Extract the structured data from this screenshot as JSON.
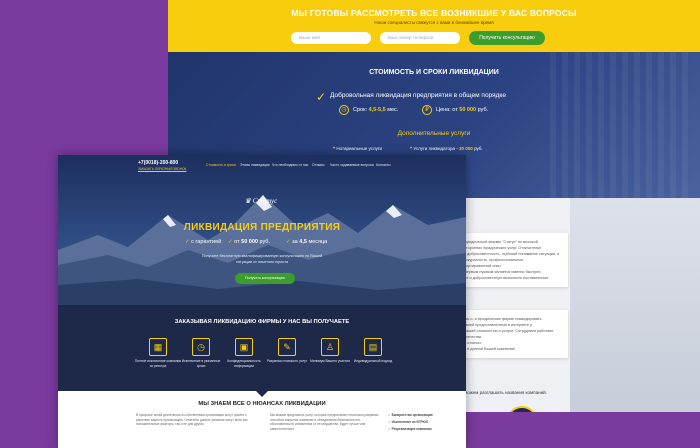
{
  "back": {
    "title": "МЫ ГОТОВЫ РАССМОТРЕТЬ ВСЕ ВОЗНИКШИЕ У ВАС ВОПРОСЫ",
    "subtitle": "Наши специалисты свяжутся с вами в ближайшее время",
    "name_placeholder": "Ваше имя",
    "phone_placeholder": "Ваш номер телефона",
    "consult_button": "Получить консультацию",
    "cost_title": "СТОИМОСТЬ И СРОКИ ЛИКВИДАЦИИ",
    "voluntary": "Добровольная ликвидация предприятия в общем порядке",
    "term_label": "Срок:",
    "term_value": "4,5-5,5",
    "term_unit": "мес.",
    "price_label": "Цена: от",
    "price_value": "50 000",
    "price_unit": "руб.",
    "additional_title": "Дополнительные услуги",
    "service1": "Нотариальные услуги",
    "service2_label": "Услуги ликвидатора -",
    "service2_value": "30 000",
    "service2_unit": "руб.",
    "card1_lines": [
      "юридической фирмы \"Статус\" по высокой",
      "сторонних юридических услуг. Отличительн",
      "и добросовестность, глубокий понимание ситуации, и аккуратность, профессиональное",
      "сортированный опыт.",
      "Первым нужным является именно быстрее,",
      "ют и добросовестную выполнить поставленные"
    ],
    "card2_lines": [
      "мы и, в юридические фирме ликвидировать",
      "своей предоставленный в интернете у",
      "нашей стоимостью и услуги: Сотрудники работают",
      "агентства",
      "и отлично",
      "и в данной Вашей компании!"
    ],
    "bottom_line": "не можем разглашать названия компаний."
  },
  "front": {
    "phone": "+7(0018)-200-800",
    "callback": "ЗАКАЗАТЬ ОБРАТНЫЙ ЗВОНОК",
    "nav": [
      "Стоимость и сроки",
      "Этапы ликвидации",
      "Что необходимо от нас",
      "Отзывы",
      "Часто задаваемые вопросы",
      "Контакты"
    ],
    "logo": "Статус",
    "hero_title": "ЛИКВИДАЦИЯ ПРЕДПРИЯТИЯ",
    "feat1": "с гарантией",
    "feat2_pre": "от",
    "feat2_val": "50 000",
    "feat2_unit": "руб.",
    "feat3_pre": "за",
    "feat3_val": "4,5",
    "feat3_unit": "месяца",
    "hero_text": "Получите бесплатную квалифицированную консультацию по Вашей ситуации от опытного юриста",
    "hero_button": "Получить консультацию",
    "dark_title": "ЗАКАЗЫВАЯ ЛИКВИДАЦИЮ ФИРМЫ У НАС ВЫ ПОЛУЧАЕТЕ",
    "benefits": [
      {
        "icon": "calculator-icon",
        "glyph": "▦",
        "text": "Полное исключение компании из реестра"
      },
      {
        "icon": "clock-icon",
        "glyph": "◷",
        "text": "Исключение в указанные сроки"
      },
      {
        "icon": "lock-icon",
        "glyph": "▣",
        "text": "Конфиденциальность информации"
      },
      {
        "icon": "chat-icon",
        "glyph": "✎",
        "text": "Разумная стоимость услуг"
      },
      {
        "icon": "person-icon",
        "glyph": "♙",
        "text": "Минимум Вашего участия"
      },
      {
        "icon": "briefcase-icon",
        "glyph": "▤",
        "text": "Индивидуальный подход"
      }
    ],
    "white_title": "МЫ ЗНАЕМ ВСЕ О НЮАНСАХ ЛИКВИДАЦИИ",
    "para_left": "В процессе своей деятельности собственники организации могут прийти к решению закрыть организацию. Отмечено данное решение могут быть как положительные факторы, так и не для других.",
    "para_right": "Мы можем предложить услуг, которые предполагает несколько разумных способов закрытия компании и объединения безопасности и обоснованности избавления от ее имущества. Будет лучше чем самостоятельно.",
    "checks": [
      "Банкротство организации",
      "Исключение из ЕГРЮЛ",
      "Реорганизация компании"
    ]
  }
}
